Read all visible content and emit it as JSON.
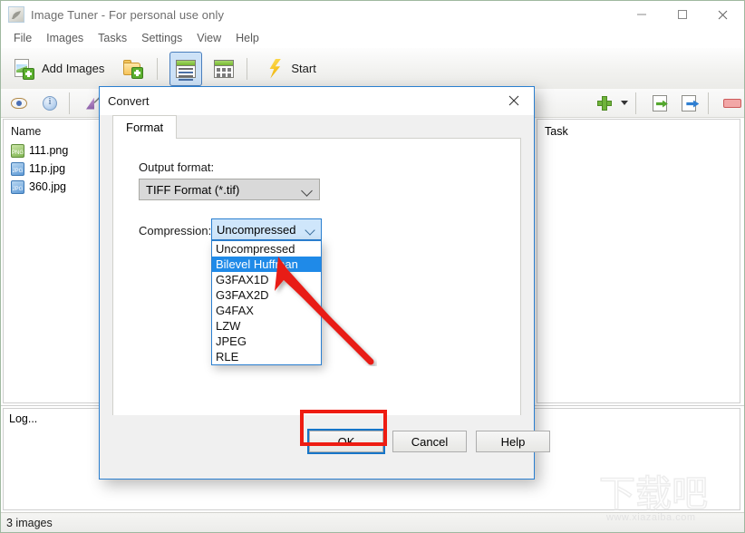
{
  "window": {
    "title": "Image Tuner - For personal use only",
    "icon": "app-icon",
    "controls": {
      "minimize": "minimize-icon",
      "maximize": "maximize-icon",
      "close": "close-icon"
    }
  },
  "menu": {
    "items": [
      {
        "label": "File"
      },
      {
        "label": "Images"
      },
      {
        "label": "Tasks"
      },
      {
        "label": "Settings"
      },
      {
        "label": "View"
      },
      {
        "label": "Help"
      }
    ]
  },
  "toolbar": {
    "add_images_label": "Add Images",
    "add_folder_icon": "folder-add-icon",
    "list_view_icon": "list-view-icon",
    "grid_view_icon": "grid-view-icon",
    "start_label": "Start",
    "start_icon": "lightning-bolt-icon"
  },
  "left_panel": {
    "tools": [
      {
        "icon": "eye-icon",
        "name": "preview"
      },
      {
        "icon": "info-icon",
        "name": "properties"
      },
      {
        "icon": "chart-icon",
        "name": "histogram"
      }
    ],
    "column_header": "Name",
    "files": [
      {
        "name": "111.png",
        "type": "PNG"
      },
      {
        "name": "11p.jpg",
        "type": "JPG"
      },
      {
        "name": "360.jpg",
        "type": "JPG"
      }
    ]
  },
  "right_panel": {
    "tools": [
      {
        "icon": "plus-icon",
        "name": "add-task"
      },
      {
        "icon": "chevron-down-icon",
        "name": "add-task-dropdown"
      },
      {
        "icon": "export-green-icon",
        "name": "import-tasks"
      },
      {
        "icon": "export-blue-icon",
        "name": "export-tasks"
      },
      {
        "icon": "minus-icon",
        "name": "remove-task"
      }
    ],
    "column_header": "Task"
  },
  "log": {
    "label": "Log..."
  },
  "status": {
    "text": "3 images"
  },
  "dialog": {
    "title": "Convert",
    "close_icon": "close-icon",
    "tab": {
      "label": "Format"
    },
    "output_format": {
      "label": "Output format:",
      "value": "TIFF Format (*.tif)",
      "chevron": "chevron-down-icon"
    },
    "compression": {
      "label": "Compression:",
      "value": "Uncompressed",
      "chevron": "chevron-down-icon",
      "options": [
        "Uncompressed",
        "Bilevel Huffman",
        "G3FAX1D",
        "G3FAX2D",
        "G4FAX",
        "LZW",
        "JPEG",
        "RLE"
      ],
      "selected_index": 1
    },
    "buttons": {
      "ok": "OK",
      "cancel": "Cancel",
      "help": "Help"
    }
  },
  "annotations": {
    "arrow": "red-arrow-pointing-to-bilevel-huffman",
    "box": "red-box-around-ok-button",
    "accent_blue": "#1f8ae8",
    "annotation_red": "#ee1c12"
  },
  "watermark": {
    "cn": "下载吧",
    "url": "www.xiazaiba.com"
  }
}
